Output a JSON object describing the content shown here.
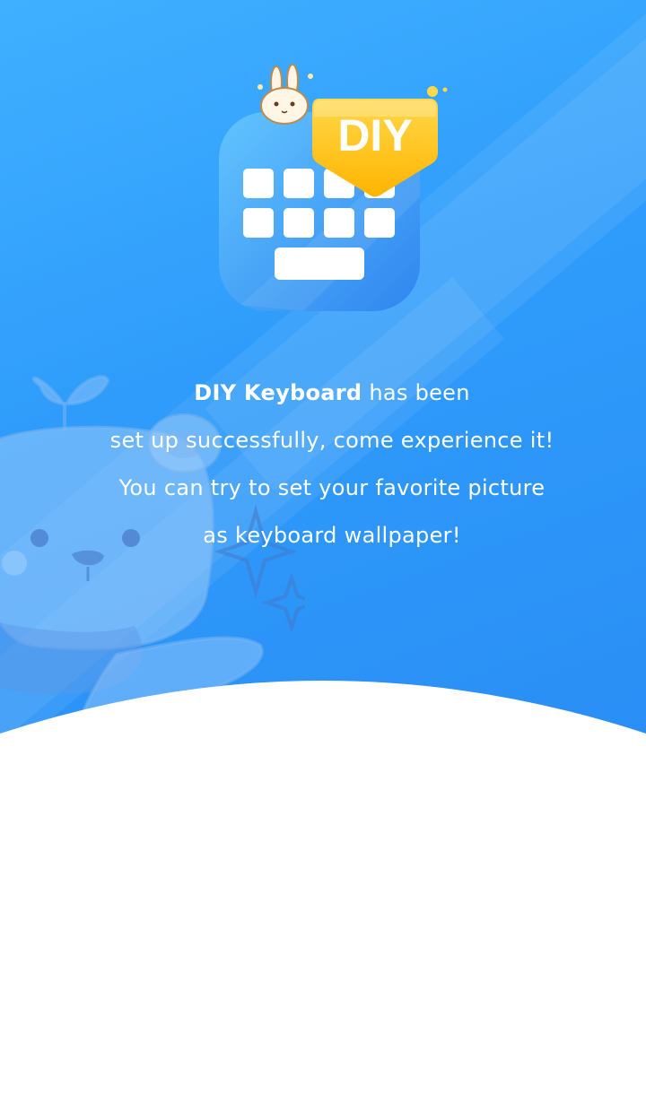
{
  "app": {
    "icon_badge": "DIY",
    "icon_name": "diy-keyboard-app-icon"
  },
  "message": {
    "line1_bold": "DIY Keyboard",
    "line1_rest": " has been",
    "line2": "set up successfully, come experience it!",
    "line3": "You can try to set your favorite picture",
    "line4": "as keyboard wallpaper!"
  },
  "colors": {
    "hero_top": "#3fb0ff",
    "hero_bottom": "#2a8ef5",
    "badge_yellow": "#ffc41a",
    "background": "#ffffff"
  }
}
